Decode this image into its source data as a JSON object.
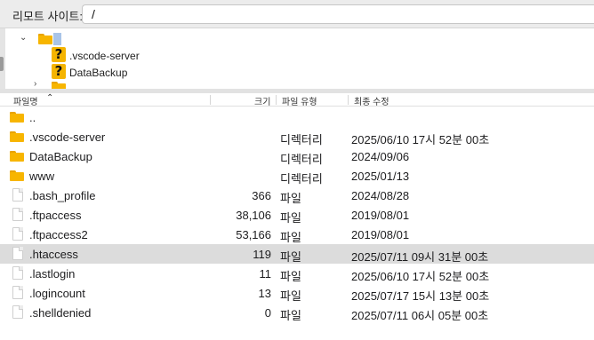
{
  "address": {
    "label": "리모트 사이트:",
    "value": "/"
  },
  "tree": {
    "root_chevron": "⌄",
    "children": [
      {
        "label": ".vscode-server"
      },
      {
        "label": "DataBackup"
      }
    ],
    "partial_chevron": "›"
  },
  "columns": {
    "name": "파일명",
    "size": "크기",
    "type": "파일 유형",
    "modified": "최종 수정",
    "sort_indicator": "⌃"
  },
  "files": [
    {
      "icon": "folder",
      "name": "..",
      "size": "",
      "type": "",
      "modified": ""
    },
    {
      "icon": "folder",
      "name": ".vscode-server",
      "size": "",
      "type": "디렉터리",
      "modified": "2025/06/10 17시 52분 00초"
    },
    {
      "icon": "folder",
      "name": "DataBackup",
      "size": "",
      "type": "디렉터리",
      "modified": "2024/09/06"
    },
    {
      "icon": "folder",
      "name": "www",
      "size": "",
      "type": "디렉터리",
      "modified": "2025/01/13"
    },
    {
      "icon": "file",
      "name": ".bash_profile",
      "size": "366",
      "type": "파일",
      "modified": "2024/08/28"
    },
    {
      "icon": "file",
      "name": ".ftpaccess",
      "size": "38,106",
      "type": "파일",
      "modified": "2019/08/01"
    },
    {
      "icon": "file",
      "name": ".ftpaccess2",
      "size": "53,166",
      "type": "파일",
      "modified": "2019/08/01"
    },
    {
      "icon": "file",
      "name": ".htaccess",
      "size": "119",
      "type": "파일",
      "modified": "2025/07/11 09시 31분 00초",
      "selected": true
    },
    {
      "icon": "file",
      "name": ".lastlogin",
      "size": "11",
      "type": "파일",
      "modified": "2025/06/10 17시 52분 00초"
    },
    {
      "icon": "file",
      "name": ".logincount",
      "size": "13",
      "type": "파일",
      "modified": "2025/07/17 15시 13분 00초"
    },
    {
      "icon": "file",
      "name": ".shelldenied",
      "size": "0",
      "type": "파일",
      "modified": "2025/07/11 06시 05분 00초"
    }
  ]
}
